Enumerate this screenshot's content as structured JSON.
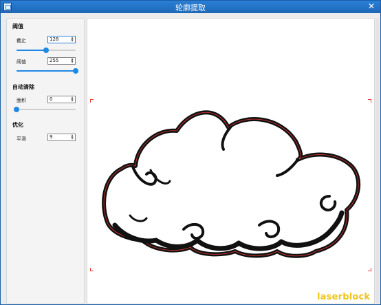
{
  "window": {
    "title": "轮廓提取",
    "close_glyph": "✕"
  },
  "panel": {
    "threshold_section": "阈值",
    "cutoff_label": "截止",
    "cutoff_value": "128",
    "cutoff_slider_value": 128,
    "threshold_label": "阈值",
    "threshold_value": "255",
    "threshold_slider_value": 255,
    "slider_max": 255,
    "auto_clear_section": "自动清除",
    "area_label": "面积",
    "area_value": "0",
    "area_slider_value": 0,
    "optimize_section": "优化",
    "smooth_label": "平滑",
    "smooth_value": "9"
  },
  "spin_arrows": "▲▼",
  "icons": [
    "app-icon",
    "close-icon",
    "cloud-contour-image"
  ],
  "colors": {
    "titlebar": "#1d67b6",
    "accent": "#1e88e5",
    "contour_outline": "#e53935",
    "watermark": "#f0c419"
  },
  "watermark": "laserblock"
}
